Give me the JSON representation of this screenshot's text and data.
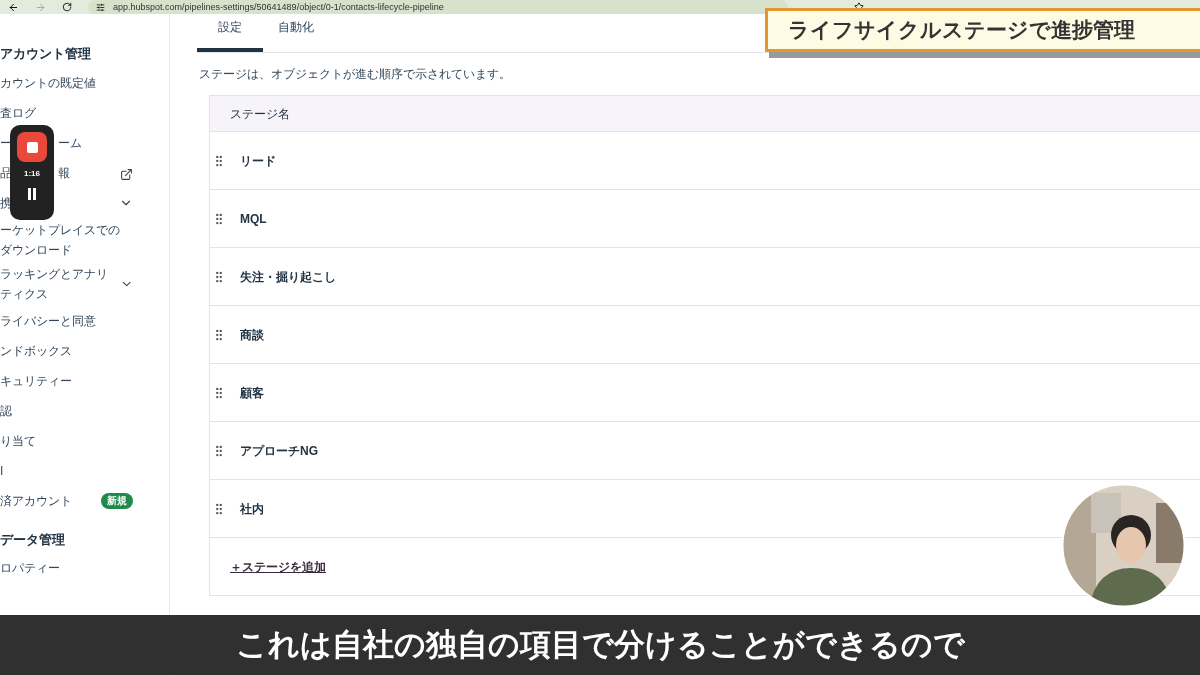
{
  "browser": {
    "url": "app.hubspot.com/pipelines-settings/50641489/object/0-1/contacts-lifecycle-pipeline"
  },
  "sidebar": {
    "sections": [
      {
        "title": "アカウント管理",
        "items": [
          {
            "left": "カウントの既定値"
          },
          {
            "left": "査ログ"
          },
          {
            "left": "ー",
            "text": "ーム"
          },
          {
            "left": "品",
            "text": "報",
            "kind": "external"
          },
          {
            "left": "携",
            "kind": "expand"
          },
          {
            "left": "ーケットプレイスでのダウンロード"
          },
          {
            "left": "ラッキングとアナリティクス",
            "kind": "expand"
          },
          {
            "left": "ライバシーと同意"
          },
          {
            "left": "ンドボックス"
          },
          {
            "left": "キュリティー"
          },
          {
            "left": "認"
          },
          {
            "left": "り当て"
          },
          {
            "left": "I"
          },
          {
            "left": "済アカウント",
            "badge": "新規"
          }
        ]
      },
      {
        "title": "データ管理",
        "items": [
          {
            "left": "ロパティー"
          }
        ]
      }
    ]
  },
  "recorder": {
    "time": "1:16"
  },
  "tabs": [
    {
      "label": "設定",
      "selected": true
    },
    {
      "label": "自動化",
      "selected": false
    }
  ],
  "description": "ステージは、オブジェクトが進む順序で示されています。",
  "table": {
    "columns": [
      "ステージ名"
    ],
    "rows": [
      "リード",
      "MQL",
      "失注・掘り起こし",
      "商談",
      "顧客",
      "アプローチNG",
      "社内"
    ],
    "add_link": "＋ステージを追加"
  },
  "banner": "ライフサイクルステージで進捗管理",
  "subtitle": "これは自社の独自の項目で分けることができるので"
}
